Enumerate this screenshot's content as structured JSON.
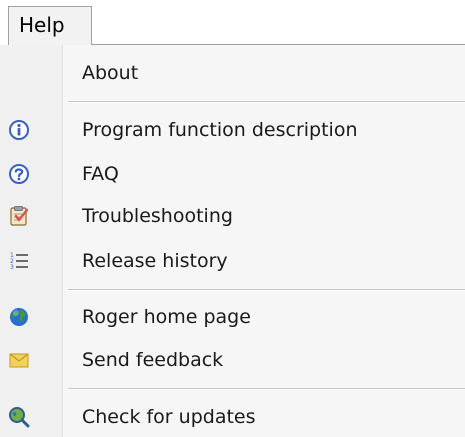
{
  "menubar": {
    "help_label": "Help"
  },
  "menu": {
    "items": [
      {
        "label": "About",
        "icon": "none"
      },
      {
        "label": "Program function description",
        "icon": "info-icon"
      },
      {
        "label": "FAQ",
        "icon": "question-icon"
      },
      {
        "label": "Troubleshooting",
        "icon": "clipboard-check-icon"
      },
      {
        "label": "Release history",
        "icon": "numbered-list-icon"
      },
      {
        "label": "Roger home page",
        "icon": "globe-icon"
      },
      {
        "label": "Send feedback",
        "icon": "envelope-icon"
      },
      {
        "label": "Check for updates",
        "icon": "magnifier-globe-icon"
      }
    ]
  },
  "colors": {
    "icon_blue": "#3a5fc8",
    "globe_green": "#3e9a3a",
    "globe_blue": "#2a6fd0",
    "envelope_yellow": "#f4d25a",
    "clipboard_red": "#d9534f"
  }
}
